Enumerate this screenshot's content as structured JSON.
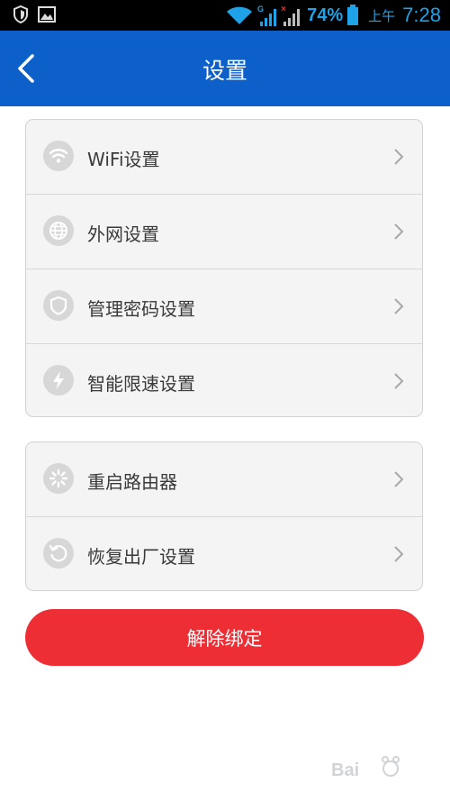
{
  "status_bar": {
    "battery_percent": "74%",
    "am_pm": "上午",
    "time": "7:28",
    "signal_badge_1": "G",
    "signal_badge_2": "×"
  },
  "header": {
    "title": "设置"
  },
  "groups": [
    {
      "items": [
        {
          "label": "WiFi设置",
          "icon": "wifi-icon"
        },
        {
          "label": "外网设置",
          "icon": "globe-icon"
        },
        {
          "label": "管理密码设置",
          "icon": "shield-icon"
        },
        {
          "label": "智能限速设置",
          "icon": "lightning-icon"
        }
      ]
    },
    {
      "items": [
        {
          "label": "重启路由器",
          "icon": "restart-icon"
        },
        {
          "label": "恢复出厂设置",
          "icon": "restore-icon"
        }
      ]
    }
  ],
  "unbind_button": {
    "label": "解除绑定"
  },
  "colors": {
    "header_bg": "#0d5fc9",
    "button_red": "#ee2e35",
    "status_accent": "#1fa2e8"
  }
}
